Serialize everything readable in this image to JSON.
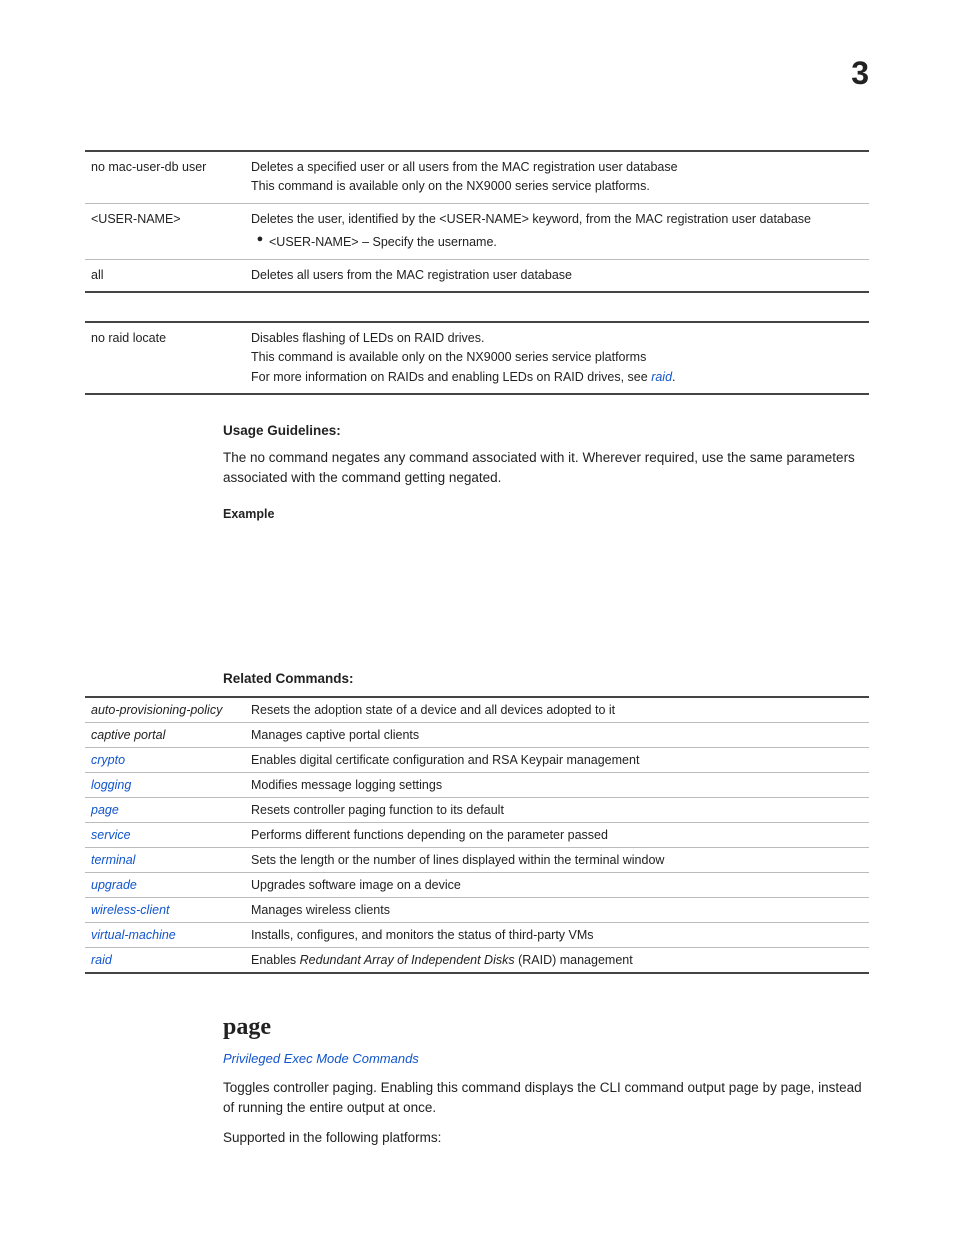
{
  "page_number": "3",
  "table1": {
    "rows": [
      {
        "cmd": "no mac-user-db user",
        "lines": [
          "Deletes a specified user or all users from the MAC registration user database",
          "This command is available only on the NX9000 series service platforms."
        ]
      },
      {
        "cmd": "<USER-NAME>",
        "line1": "Deletes the user, identified by the <USER-NAME> keyword, from the MAC registration user database",
        "bullet": "<USER-NAME> – Specify the username."
      },
      {
        "cmd": "all",
        "lines": [
          "Deletes all users from the MAC registration user database"
        ]
      }
    ]
  },
  "table2": {
    "cmd": "no raid locate",
    "line1": "Disables flashing of LEDs on RAID drives.",
    "line2": "This command is available only on the NX9000 series service platforms",
    "line3_a": "For more information on RAIDs and enabling LEDs on RAID drives, see ",
    "line3_link": "raid",
    "line3_b": "."
  },
  "usage_heading": "Usage Guidelines:",
  "usage_body": "The no command negates any command associated with it. Wherever required, use the same parameters associated with the command getting negated.",
  "example_heading": "Example",
  "related_heading": "Related Commands:",
  "related": [
    {
      "cmd": "auto-provisioning-policy",
      "link": false,
      "desc": "Resets the adoption state of a device and all devices adopted to it"
    },
    {
      "cmd": "captive portal",
      "link": false,
      "desc": "Manages captive portal clients"
    },
    {
      "cmd": "crypto",
      "link": true,
      "desc": "Enables digital certificate configuration and RSA Keypair management"
    },
    {
      "cmd": "logging",
      "link": true,
      "desc": "Modifies message logging settings"
    },
    {
      "cmd": "page",
      "link": true,
      "desc": "Resets controller paging function to its default"
    },
    {
      "cmd": "service",
      "link": true,
      "desc": "Performs different functions depending on the parameter passed"
    },
    {
      "cmd": "terminal",
      "link": true,
      "desc": "Sets the length or the number of lines displayed within the terminal window"
    },
    {
      "cmd": "upgrade",
      "link": true,
      "desc": "Upgrades software image on a device"
    },
    {
      "cmd": "wireless-client",
      "link": true,
      "desc": "Manages wireless clients"
    },
    {
      "cmd": "virtual-machine",
      "link": true,
      "desc": "Installs, configures, and monitors the status of third-party VMs"
    },
    {
      "cmd": "raid",
      "link": true,
      "desc_pre": "Enables ",
      "desc_em": "Redundant Array of Independent Disks",
      "desc_post": " (RAID) management"
    }
  ],
  "page_section": {
    "heading": "page",
    "breadcrumb": "Privileged Exec Mode Commands",
    "body1": "Toggles controller paging. Enabling this command displays the CLI command output page by page, instead of running the entire output at once.",
    "body2": "Supported in the following platforms:"
  }
}
